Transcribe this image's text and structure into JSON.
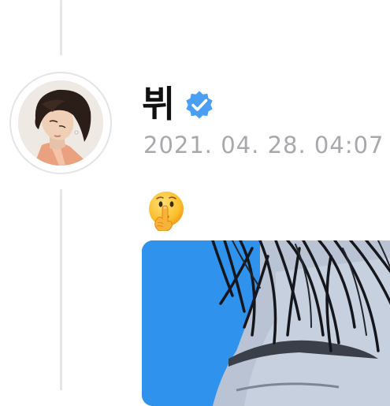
{
  "post": {
    "author": {
      "display_name": "뷔",
      "verified": true,
      "verified_icon": "verified-badge-icon",
      "avatar": "profile-photo"
    },
    "timestamp": "2021. 04. 28. 04:07",
    "emoji_icon": "shushing-face-emoji",
    "media": "photo-attachment"
  },
  "colors": {
    "verified_badge": "#4a9ff5",
    "timestamp": "#a8a8ad",
    "thread_line": "#e6e6e6",
    "image_background": "#2f93ee"
  }
}
